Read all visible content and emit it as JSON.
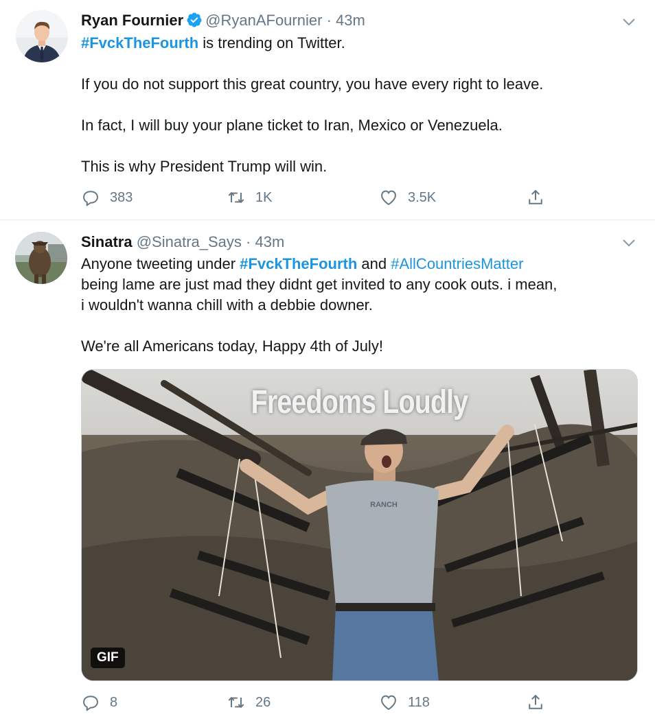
{
  "tweets": [
    {
      "author_name": "Ryan Fournier",
      "verified": true,
      "handle": "@RyanAFournier",
      "separator": "·",
      "time": "43m",
      "text_lines": [
        {
          "hashtag": "#FvckTheFourth",
          "text": " is trending on Twitter."
        },
        {
          "text": "If you do not support this great country, you have every right to leave."
        },
        {
          "text": "In fact, I will buy your plane ticket to Iran, Mexico or Venezuela."
        },
        {
          "text": "This is why President Trump will win."
        }
      ],
      "counts": {
        "replies": "383",
        "retweets": "1K",
        "likes": "3.5K"
      }
    },
    {
      "author_name": "Sinatra",
      "verified": false,
      "handle": "@Sinatra_Says",
      "separator": "·",
      "time": "43m",
      "text_lines": [
        {
          "pre": "Anyone tweeting under ",
          "hashtag": "#FvckTheFourth",
          "mid": " and ",
          "hashtag2": "#AllCountriesMatter"
        },
        {
          "text": "being lame are just mad they didnt get invited to any cook outs. i mean,"
        },
        {
          "text": "i wouldn't wanna chill with a debbie downer."
        },
        {
          "text": "We're all Americans today, Happy 4th of July!"
        }
      ],
      "media": {
        "overlay_text": "Freedoms Loudly",
        "shirt_text": "RANCH",
        "badge": "GIF"
      },
      "counts": {
        "replies": "8",
        "retweets": "26",
        "likes": "118"
      }
    }
  ],
  "colors": {
    "link": "#1b95e0",
    "secondary_text": "#657786",
    "primary_text": "#14171a",
    "verified_badge": "#1da1f2",
    "divider": "#e6ecf0"
  },
  "icons": [
    "reply-icon",
    "retweet-icon",
    "like-icon",
    "share-icon",
    "caret-down-icon",
    "verified-badge-icon"
  ]
}
